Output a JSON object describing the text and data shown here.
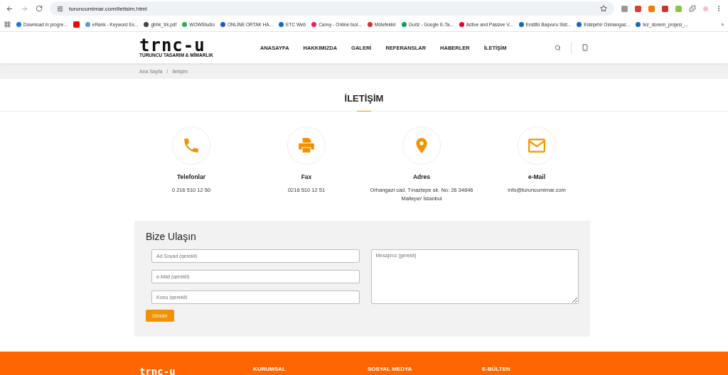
{
  "browser": {
    "url": "turuncumimar.com/iletisim.html",
    "bookmarks": [
      {
        "label": "Download in progre...",
        "color": "#1a73e8"
      },
      {
        "color": "#ff0000"
      },
      {
        "label": "eRank - Keyword Ex...",
        "color": "#5b9bd5"
      },
      {
        "label": "gbhk_trk.pdf",
        "color": "#444444"
      },
      {
        "label": "WOWStudio",
        "color": "#34a853"
      },
      {
        "label": "ONLİNE ORTAK HA...",
        "color": "#1a56db"
      },
      {
        "label": "ETC Web",
        "color": "#0f6cbd"
      },
      {
        "label": "Canvy - Online tool...",
        "color": "#e91e63"
      },
      {
        "label": "Mütefekkir",
        "color": "#d32f2f"
      },
      {
        "label": "Gurlz - Google E-Ta...",
        "color": "#0f9d58"
      },
      {
        "label": "Active and Passive V...",
        "color": "#e60023"
      },
      {
        "label": "Enstitü Başvuru Sist...",
        "color": "#1565c0"
      },
      {
        "label": "Eskişehir Osmangaz...",
        "color": "#1565c0"
      },
      {
        "label": "tez_donem_projesi_...",
        "color": "#1565c0"
      }
    ],
    "overflow": "»"
  },
  "site": {
    "logo": "trnc-u",
    "tagline": "TURUNCU TASARIM & MİMARLIK",
    "nav": [
      "ANASAYFA",
      "HAKKIMIZDA",
      "GALERİ",
      "REFERANSLAR",
      "HABERLER",
      "İLETİŞİM"
    ]
  },
  "breadcrumb": {
    "separator": "/",
    "items": [
      "Ana Sayfa",
      "İletişim"
    ]
  },
  "title": "İLETİŞİM",
  "contacts": [
    {
      "kind": "phone",
      "title": "Telefonlar",
      "lines": [
        "0 216 510 12 50"
      ]
    },
    {
      "kind": "fax",
      "title": "Fax",
      "lines": [
        "0216 510 12 51"
      ]
    },
    {
      "kind": "address",
      "title": "Adres",
      "lines": [
        "Orhangazi cad. Tınaztepe sk. No: 26 34846",
        "Maltepe/ İstanbul"
      ]
    },
    {
      "kind": "email",
      "title": "e-Mail",
      "lines": [
        "info@turuncumimar.com"
      ]
    }
  ],
  "form": {
    "title": "Bize Ulaşın",
    "fields": [
      {
        "placeholder": "Ad Soyad (gerekli)"
      },
      {
        "placeholder": "e-Mail (gerekli)"
      },
      {
        "placeholder": "Konu (gerekli)"
      }
    ],
    "message": {
      "placeholder": "Mesajınız (gerekli)"
    },
    "submit": "Gönder"
  },
  "footer": {
    "logo": "trnc-u",
    "columns": [
      "KURUMSAL",
      "SOSYAL MEDYA",
      "E-BÜLTEN"
    ]
  }
}
